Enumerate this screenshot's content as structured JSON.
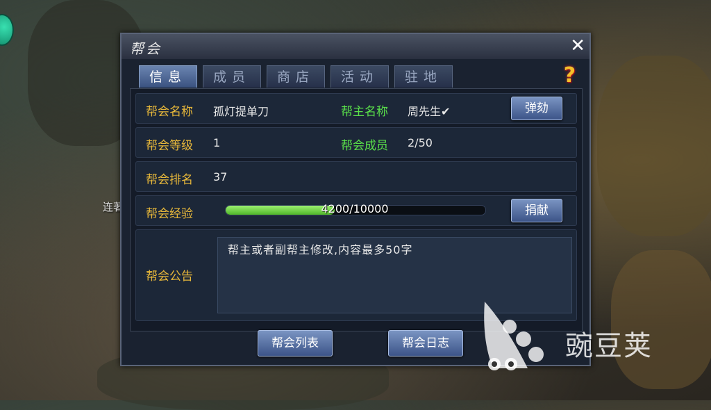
{
  "side_text": "连著",
  "panel": {
    "title": "帮会",
    "close_label": "✕",
    "help_label": "?"
  },
  "tabs": [
    {
      "label": "信息",
      "active": true
    },
    {
      "label": "成员",
      "active": false
    },
    {
      "label": "商店",
      "active": false
    },
    {
      "label": "活动",
      "active": false
    },
    {
      "label": "驻地",
      "active": false
    }
  ],
  "info": {
    "guild_name_label": "帮会名称",
    "guild_name": "孤灯提单刀",
    "leader_label": "帮主名称",
    "leader_name": "周先生✔",
    "impeach_button": "弹劾",
    "level_label": "帮会等级",
    "level": "1",
    "members_label": "帮会成员",
    "members": "2/50",
    "rank_label": "帮会排名",
    "rank": "37",
    "exp_label": "帮会经验",
    "exp_text": "4200/10000",
    "exp_fraction": 0.42,
    "donate_button": "捐献",
    "notice_label": "帮会公告",
    "notice_text": "帮主或者副帮主修改,内容最多50字"
  },
  "bottom": {
    "guild_list_button": "帮会列表",
    "guild_log_button": "帮会日志"
  },
  "watermark": {
    "text": "豌豆荚"
  },
  "colors": {
    "label_gold": "#e8b83a",
    "label_green": "#5ae04a",
    "exp_bar": "#6ad040"
  }
}
